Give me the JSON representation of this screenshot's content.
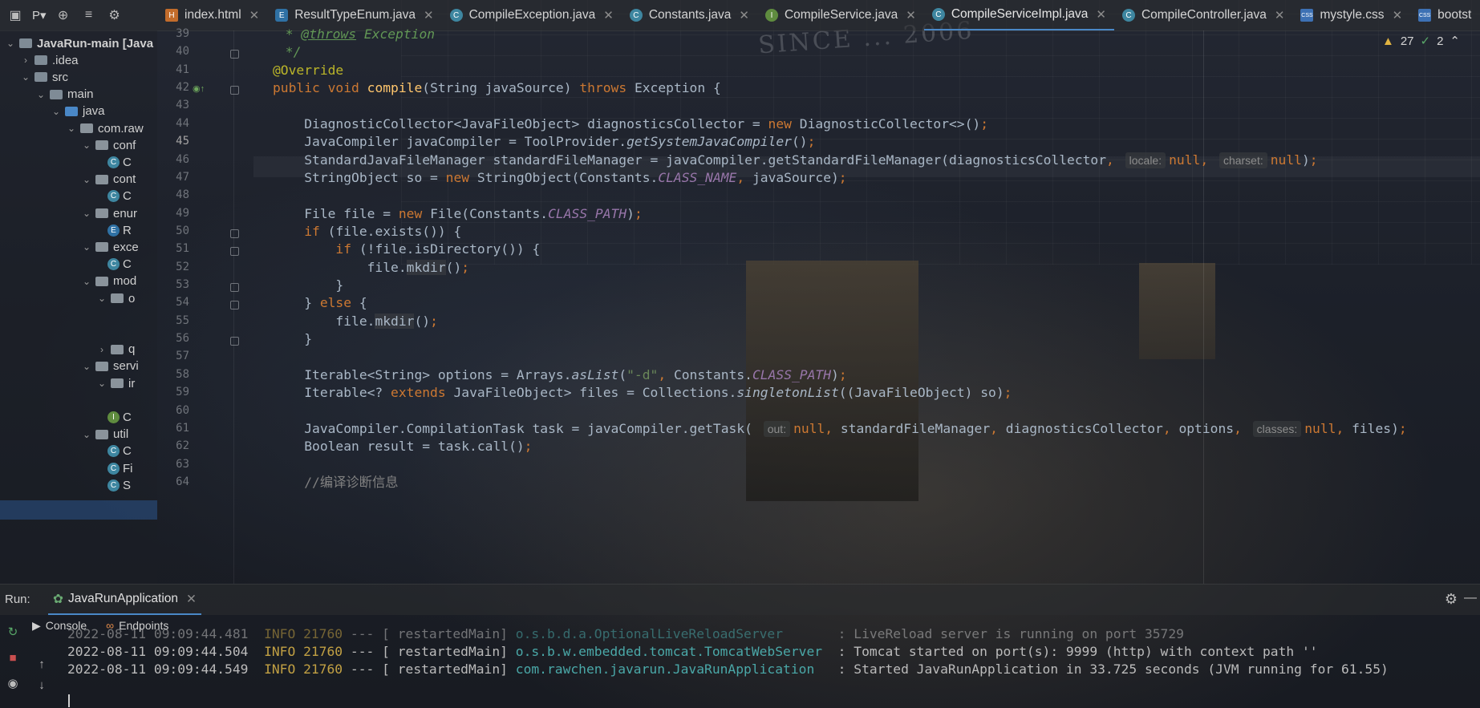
{
  "project": {
    "header_label": "P▾",
    "tree": [
      {
        "label": "JavaRun-main [Java",
        "indent": 0,
        "chev": "⌄",
        "kind": "root"
      },
      {
        "label": ".idea",
        "indent": 1,
        "chev": "›",
        "kind": "folder"
      },
      {
        "label": "src",
        "indent": 1,
        "chev": "⌄",
        "kind": "folder"
      },
      {
        "label": "main",
        "indent": 2,
        "chev": "⌄",
        "kind": "folder"
      },
      {
        "label": "java",
        "indent": 3,
        "chev": "⌄",
        "kind": "folder-blue"
      },
      {
        "label": "com.raw",
        "indent": 4,
        "chev": "⌄",
        "kind": "package"
      },
      {
        "label": "conf",
        "indent": 5,
        "chev": "⌄",
        "kind": "package"
      },
      {
        "label": "C",
        "indent": 6,
        "chev": "",
        "kind": "class"
      },
      {
        "label": "cont",
        "indent": 5,
        "chev": "⌄",
        "kind": "package"
      },
      {
        "label": "C",
        "indent": 6,
        "chev": "",
        "kind": "class"
      },
      {
        "label": "enur",
        "indent": 5,
        "chev": "⌄",
        "kind": "package"
      },
      {
        "label": "R",
        "indent": 6,
        "chev": "",
        "kind": "enum"
      },
      {
        "label": "exce",
        "indent": 5,
        "chev": "⌄",
        "kind": "package"
      },
      {
        "label": "C",
        "indent": 6,
        "chev": "",
        "kind": "class"
      },
      {
        "label": "mod",
        "indent": 5,
        "chev": "⌄",
        "kind": "package"
      },
      {
        "label": "o",
        "indent": 6,
        "chev": "⌄",
        "kind": "package"
      },
      {
        "label": "",
        "indent": 6,
        "chev": "",
        "kind": "blank"
      },
      {
        "label": "",
        "indent": 6,
        "chev": "",
        "kind": "blank"
      },
      {
        "label": "q",
        "indent": 6,
        "chev": "›",
        "kind": "package"
      },
      {
        "label": "servi",
        "indent": 5,
        "chev": "⌄",
        "kind": "package"
      },
      {
        "label": "ir",
        "indent": 6,
        "chev": "⌄",
        "kind": "package"
      },
      {
        "label": "",
        "indent": 6,
        "chev": "",
        "kind": "blank"
      },
      {
        "label": "C",
        "indent": 6,
        "chev": "",
        "kind": "interface"
      },
      {
        "label": "util",
        "indent": 5,
        "chev": "⌄",
        "kind": "package"
      },
      {
        "label": "C",
        "indent": 6,
        "chev": "",
        "kind": "class"
      },
      {
        "label": "Fi",
        "indent": 6,
        "chev": "",
        "kind": "class"
      },
      {
        "label": "S",
        "indent": 6,
        "chev": "",
        "kind": "class"
      }
    ]
  },
  "tabs": [
    {
      "label": "index.html",
      "icon": "h",
      "active": false
    },
    {
      "label": "ResultTypeEnum.java",
      "icon": "e",
      "active": false
    },
    {
      "label": "CompileException.java",
      "icon": "c",
      "active": false
    },
    {
      "label": "Constants.java",
      "icon": "c",
      "active": false
    },
    {
      "label": "CompileService.java",
      "icon": "i",
      "active": false
    },
    {
      "label": "CompileServiceImpl.java",
      "icon": "c",
      "active": true
    },
    {
      "label": "CompileController.java",
      "icon": "c",
      "active": false
    },
    {
      "label": "mystyle.css",
      "icon": "css",
      "active": false
    },
    {
      "label": "bootst",
      "icon": "css",
      "active": false
    }
  ],
  "inspections": {
    "warnings": "27",
    "ok": "2"
  },
  "editor": {
    "current_line": "45",
    "lines": [
      {
        "n": "39",
        "html": "<span class=\"doc\"> * </span><span class=\"doctag\">@throws</span><span class=\"doc\"> Exception</span>"
      },
      {
        "n": "40",
        "html": "<span class=\"doc\"> */</span>"
      },
      {
        "n": "41",
        "html": "<span class=\"an\">@Override</span>"
      },
      {
        "n": "42",
        "html": "<span class=\"kw\">public void </span><span class=\"fn\">compile</span>(String javaSource) <span class=\"kw\">throws </span>Exception {"
      },
      {
        "n": "43",
        "html": ""
      },
      {
        "n": "44",
        "html": "    DiagnosticCollector&lt;JavaFileObject&gt; diagnosticsCollector = <span class=\"kw\">new </span>DiagnosticCollector&lt;&gt;()<span class=\"kw\">;</span>"
      },
      {
        "n": "45",
        "html": "    JavaCompiler javaCompiler = ToolProvider.<span class=\"it\">getSystemJavaCompiler</span>()<span class=\"kw\">;</span>"
      },
      {
        "n": "46",
        "html": "    StandardJavaFileManager standardFileManager = javaCompiler.getStandardFileManager(diagnosticsCollector<span class=\"kw\">, </span><span class=\"hint\">locale:</span><span class=\"kw\">null, </span><span class=\"hint\">charset:</span><span class=\"kw\">null</span>)<span class=\"kw\">;</span>"
      },
      {
        "n": "47",
        "html": "    StringObject so = <span class=\"kw\">new </span>StringObject(Constants.<span class=\"st\">CLASS_NAME</span><span class=\"kw\">, </span>javaSource)<span class=\"kw\">;</span>"
      },
      {
        "n": "48",
        "html": ""
      },
      {
        "n": "49",
        "html": "    File file = <span class=\"kw\">new </span>File(Constants.<span class=\"st\">CLASS_PATH</span>)<span class=\"kw\">;</span>"
      },
      {
        "n": "50",
        "html": "    <span class=\"kw\">if </span>(file.exists()) {"
      },
      {
        "n": "51",
        "html": "        <span class=\"kw\">if </span>(!file.isDirectory()) {"
      },
      {
        "n": "52",
        "html": "            file.<span class=\"hl\">mkdir</span>()<span class=\"kw\">;</span>"
      },
      {
        "n": "53",
        "html": "        }"
      },
      {
        "n": "54",
        "html": "    } <span class=\"kw\">else </span>{"
      },
      {
        "n": "55",
        "html": "        file.<span class=\"hl\">mkdir</span>()<span class=\"kw\">;</span>"
      },
      {
        "n": "56",
        "html": "    }"
      },
      {
        "n": "57",
        "html": ""
      },
      {
        "n": "58",
        "html": "    Iterable&lt;String&gt; options = Arrays.<span class=\"it\">asList</span>(<span class=\"str\">\"-d\"</span><span class=\"kw\">, </span>Constants.<span class=\"st\">CLASS_PATH</span>)<span class=\"kw\">;</span>"
      },
      {
        "n": "59",
        "html": "    Iterable&lt;? <span class=\"kw\">extends </span>JavaFileObject&gt; files = Collections.<span class=\"it\">singletonList</span>((JavaFileObject) so)<span class=\"kw\">;</span>"
      },
      {
        "n": "60",
        "html": ""
      },
      {
        "n": "61",
        "html": "    JavaCompiler.CompilationTask task = javaCompiler.getTask( <span class=\"hint\">out:</span><span class=\"kw\">null, </span>standardFileManager<span class=\"kw\">, </span>diagnosticsCollector<span class=\"kw\">, </span>options<span class=\"kw\">, </span><span class=\"hint\">classes:</span><span class=\"kw\">null, </span>files)<span class=\"kw\">;</span>"
      },
      {
        "n": "62",
        "html": "    Boolean result = task.call()<span class=\"kw\">;</span>"
      },
      {
        "n": "63",
        "html": ""
      },
      {
        "n": "64",
        "html": "    <span class=\"cm\">//编译诊断信息</span>"
      }
    ]
  },
  "run": {
    "label": "Run:",
    "config": "JavaRunApplication",
    "subtabs": {
      "console": "Console",
      "endpoints": "Endpoints"
    },
    "console_lines": [
      {
        "date": "2022-08-11 09:09:44.481",
        "level": "INFO",
        "pid": "21760",
        "sep": "--- [",
        "thread": " restartedMain]",
        "logger": "o.s.b.d.a.OptionalLiveReloadServer      ",
        "msg": " : LiveReload server is running on port 35729"
      },
      {
        "date": "2022-08-11 09:09:44.504",
        "level": "INFO",
        "pid": "21760",
        "sep": "--- [",
        "thread": " restartedMain]",
        "logger": "o.s.b.w.embedded.tomcat.TomcatWebServer ",
        "msg": " : Tomcat started on port(s): 9999 (http) with context path ''"
      },
      {
        "date": "2022-08-11 09:09:44.549",
        "level": "INFO",
        "pid": "21760",
        "sep": "--- [",
        "thread": " restartedMain]",
        "logger": "com.rawchen.javarun.JavaRunApplication  ",
        "msg": " : Started JavaRunApplication in 33.725 seconds (JVM running for 61.55)"
      }
    ]
  },
  "colors": {
    "accent": "#4a88c7",
    "keyword": "#cc7832",
    "function": "#ffc66d",
    "annotation": "#bbb529",
    "static": "#9876aa"
  }
}
